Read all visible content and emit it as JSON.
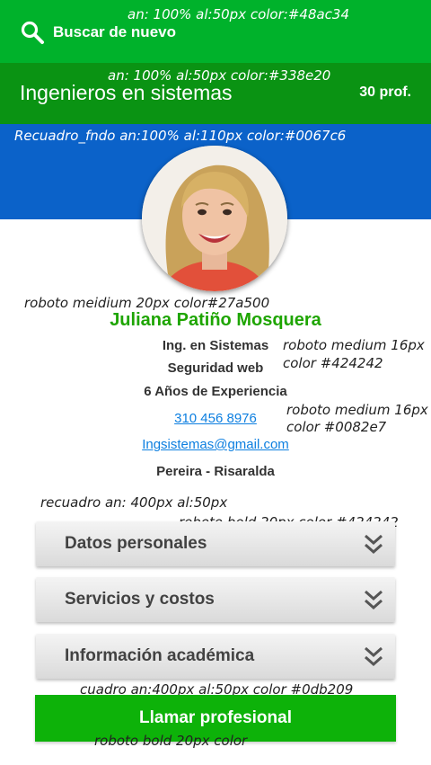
{
  "search": {
    "label": "Buscar de nuevo"
  },
  "header": {
    "title": "Ingenieros en sistemas",
    "count": "30 prof."
  },
  "profile": {
    "name": "Juliana Patiño Mosquera",
    "profession": "Ing. en Sistemas",
    "specialty": "Seguridad web",
    "experience": "6 Años de Experiencia",
    "phone": "310 456 8976",
    "email": "Ingsistemas@gmail.com",
    "location": "Pereira - Risaralda"
  },
  "sections": [
    {
      "label": "Datos personales"
    },
    {
      "label": "Servicios y costos"
    },
    {
      "label": "Información académica"
    }
  ],
  "call_button": {
    "label": "Llamar profesional"
  },
  "annotations": {
    "topbar": "an: 100% al:50px color:#48ac34",
    "titlebar": "an: 100% al:50px color:#338e20",
    "bluebg": "Recuadro_fndo an:100% al:110px color:#0067c6",
    "name_font": "roboto meidium 20px color#27a500",
    "info_font_1": "roboto medium 16px",
    "info_font_2": "color #424242",
    "link_font_1": "roboto medium 16px",
    "link_font_2": "color #0082e7",
    "box_size": "recuadro an: 400px al:50px",
    "box_font": "roboto bold 20px color #424242",
    "button_size": "cuadro an:400px al:50px color #0db209",
    "button_font": "roboto bold 20px color"
  },
  "colors": {
    "topbar": "#00b22b",
    "titlebar": "#0a9313",
    "bluebg": "#0b62c9",
    "name": "#1ea500",
    "link": "#0d7fe0",
    "button": "#0db209"
  }
}
